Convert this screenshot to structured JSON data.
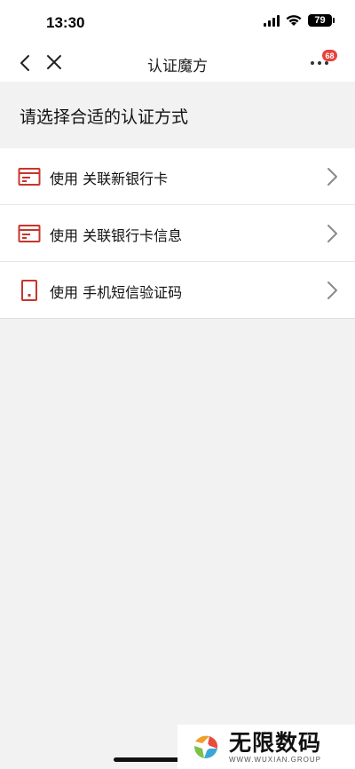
{
  "status_bar": {
    "time": "13:30",
    "battery": "79"
  },
  "nav": {
    "title": "认证魔方",
    "more_badge": "68"
  },
  "section": {
    "title": "请选择合适的认证方式"
  },
  "options": [
    {
      "label": "使用 关联新银行卡",
      "icon": "card-icon"
    },
    {
      "label": "使用 关联银行卡信息",
      "icon": "card-icon"
    },
    {
      "label": "使用 手机短信验证码",
      "icon": "phone-icon"
    }
  ],
  "watermark": {
    "title": "无限数码",
    "subtitle": "WWW.WUXIAN.GROUP"
  },
  "colors": {
    "accent_red": "#c8352c",
    "badge_red": "#e9413b",
    "chevron_gray": "#8a8a8a",
    "background": "#f2f2f2"
  }
}
